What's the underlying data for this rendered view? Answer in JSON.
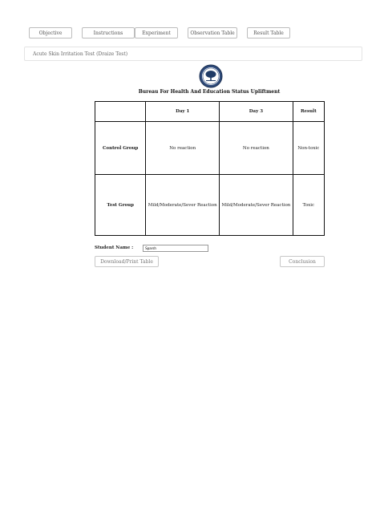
{
  "tabs": [
    {
      "label": "Objective"
    },
    {
      "label": "Instructions"
    },
    {
      "label": "Experiment"
    },
    {
      "label": "Observation Table"
    },
    {
      "label": "Result Table"
    }
  ],
  "page_title": "Acute Skin Irritation Test (Draize Test)",
  "bureau_title": "Bureau For Health And Education Status Upliftment",
  "table": {
    "headers": [
      "",
      "Day 1",
      "Day 3",
      "Result"
    ],
    "rows": [
      {
        "label": "Control Group",
        "day1": "No reaction",
        "day3": "No reaction",
        "result": "Non-toxic"
      },
      {
        "label": "Test Group",
        "day1": "Mild/Moderate/Sever Reaction",
        "day3": "Mild/Moderate/Sever Reaction",
        "result": "Toxic"
      }
    ]
  },
  "student": {
    "label": "Student Name :",
    "value": "Sparsh"
  },
  "buttons": {
    "download": "Download/Print Table",
    "conclusion": "Conclusion"
  }
}
